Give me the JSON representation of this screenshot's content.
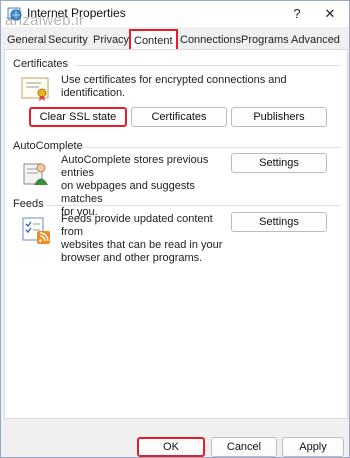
{
  "window": {
    "title": "Internet Properties",
    "watermark": "anzalweb.ir",
    "help_glyph": "?",
    "close_glyph": "✕"
  },
  "tabs": [
    {
      "label": "General"
    },
    {
      "label": "Security"
    },
    {
      "label": "Privacy"
    },
    {
      "label": "Content"
    },
    {
      "label": "Connections"
    },
    {
      "label": "Programs"
    },
    {
      "label": "Advanced"
    }
  ],
  "active_tab": "Content",
  "certificates": {
    "section_label": "Certificates",
    "description": "Use certificates for encrypted connections and identification.",
    "clear_ssl_label": "Clear SSL state",
    "certificates_label": "Certificates",
    "publishers_label": "Publishers",
    "icon": "certificate-icon"
  },
  "autocomplete": {
    "section_label": "AutoComplete",
    "description_lines": [
      "AutoComplete stores previous entries",
      "on webpages and suggests matches",
      "for you."
    ],
    "settings_label": "Settings",
    "icon": "autocomplete-icon"
  },
  "feeds": {
    "section_label": "Feeds",
    "description_lines": [
      "Feeds provide updated content from",
      "websites that can be read in your",
      "browser and other programs."
    ],
    "settings_label": "Settings",
    "icon": "feeds-icon"
  },
  "footer": {
    "ok_label": "OK",
    "cancel_label": "Cancel",
    "apply_label": "Apply"
  },
  "colors": {
    "highlight": "#e41e2b",
    "accent": "#0a64c8"
  }
}
